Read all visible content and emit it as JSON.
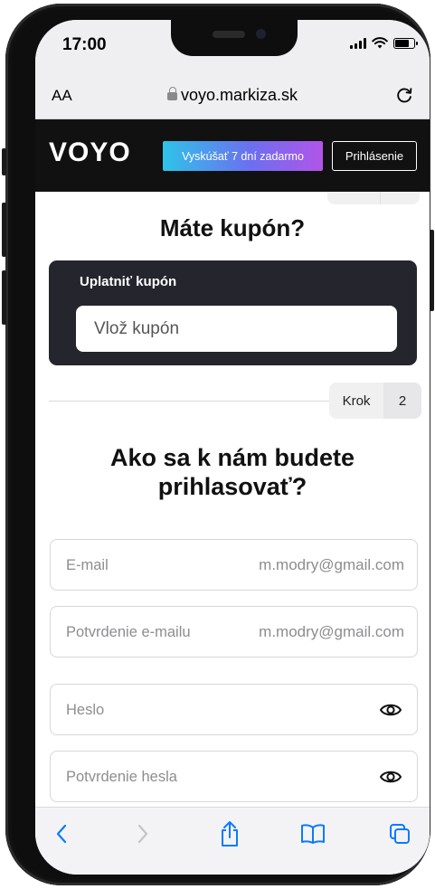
{
  "status_bar": {
    "time": "17:00"
  },
  "browser": {
    "text_size_label": "AA",
    "url": "voyo.markiza.sk"
  },
  "header": {
    "logo": "VOYO",
    "try_button": "Vyskúšať 7 dní zadarmo",
    "login_button": "Prihlásenie"
  },
  "coupon": {
    "title": "Máte kupón?",
    "label": "Uplatniť kupón",
    "placeholder": "Vlož kupón"
  },
  "step": {
    "label": "Krok",
    "number": "2"
  },
  "login": {
    "title": "Ako sa k nám budete prihlasovať?",
    "fields": [
      {
        "label": "E-mail",
        "value": "m.modry@gmail.com"
      },
      {
        "label": "Potvrdenie e-mailu",
        "value": "m.modry@gmail.com"
      },
      {
        "label": "Heslo",
        "value": ""
      },
      {
        "label": "Potvrdenie hesla",
        "value": ""
      }
    ]
  },
  "toolbar": {
    "icons": [
      "back-icon",
      "forward-icon",
      "share-icon",
      "bookmarks-icon",
      "tabs-icon"
    ],
    "accent": "#0a7aff"
  },
  "colors": {
    "header_bg": "#111111",
    "coupon_box_bg": "#25252d",
    "try_gradient": [
      "#2fc3e8",
      "#6c6ff0",
      "#b155e8"
    ]
  }
}
